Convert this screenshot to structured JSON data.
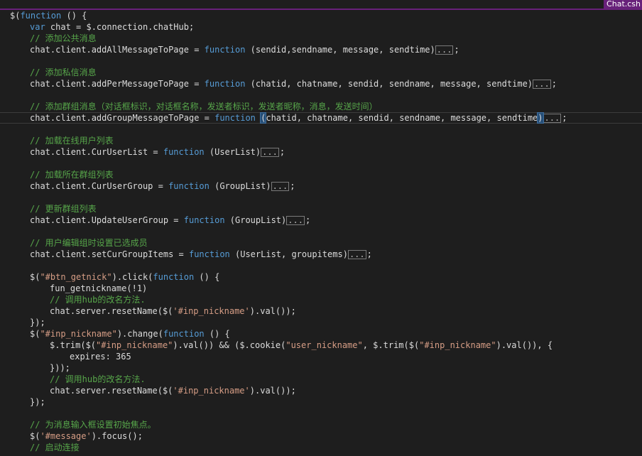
{
  "window": {
    "tab_label": "Chat.csh"
  },
  "code_lines": [
    {
      "indent": 0,
      "tokens": [
        {
          "t": "pl",
          "v": "$("
        },
        {
          "t": "kw",
          "v": "function"
        },
        {
          "t": "pl",
          "v": " () {"
        }
      ]
    },
    {
      "indent": 1,
      "tokens": [
        {
          "t": "kw",
          "v": "var"
        },
        {
          "t": "pl",
          "v": " chat = $.connection.chatHub;"
        }
      ]
    },
    {
      "indent": 1,
      "tokens": [
        {
          "t": "cmt",
          "v": "// 添加公共消息"
        }
      ]
    },
    {
      "indent": 1,
      "tokens": [
        {
          "t": "pl",
          "v": "chat.client.addAllMessageToPage = "
        },
        {
          "t": "kw",
          "v": "function"
        },
        {
          "t": "pl",
          "v": " (sendid,sendname, message, sendtime)"
        },
        {
          "t": "fold",
          "v": "..."
        },
        {
          "t": "pl",
          "v": ";"
        }
      ]
    },
    {
      "indent": 1,
      "tokens": []
    },
    {
      "indent": 1,
      "tokens": [
        {
          "t": "cmt",
          "v": "// 添加私信消息"
        }
      ]
    },
    {
      "indent": 1,
      "tokens": [
        {
          "t": "pl",
          "v": "chat.client.addPerMessageToPage = "
        },
        {
          "t": "kw",
          "v": "function"
        },
        {
          "t": "pl",
          "v": " (chatid, chatname, sendid, sendname, message, sendtime)"
        },
        {
          "t": "fold",
          "v": "..."
        },
        {
          "t": "pl",
          "v": ";"
        }
      ]
    },
    {
      "indent": 1,
      "tokens": []
    },
    {
      "indent": 1,
      "tokens": [
        {
          "t": "cmt",
          "v": "// 添加群组消息（对话框标识，对话框名称，发送者标识，发送者昵称，消息，发送时间）"
        }
      ]
    },
    {
      "indent": 1,
      "current": true,
      "tokens": [
        {
          "t": "pl",
          "v": "chat.client.addGroupMessageToPage = "
        },
        {
          "t": "kw",
          "v": "function"
        },
        {
          "t": "pl",
          "v": " "
        },
        {
          "t": "bm",
          "v": "("
        },
        {
          "t": "pl",
          "v": "chatid, chatname, sendid, sendname, message, sendtime"
        },
        {
          "t": "bm",
          "v": ")"
        },
        {
          "t": "fold",
          "v": "..."
        },
        {
          "t": "pl",
          "v": ";"
        }
      ]
    },
    {
      "indent": 1,
      "tokens": []
    },
    {
      "indent": 1,
      "tokens": [
        {
          "t": "cmt",
          "v": "// 加载在线用户列表"
        }
      ]
    },
    {
      "indent": 1,
      "tokens": [
        {
          "t": "pl",
          "v": "chat.client.CurUserList = "
        },
        {
          "t": "kw",
          "v": "function"
        },
        {
          "t": "pl",
          "v": " (UserList)"
        },
        {
          "t": "fold",
          "v": "..."
        },
        {
          "t": "pl",
          "v": ";"
        }
      ]
    },
    {
      "indent": 1,
      "tokens": []
    },
    {
      "indent": 1,
      "tokens": [
        {
          "t": "cmt",
          "v": "// 加载所在群组列表"
        }
      ]
    },
    {
      "indent": 1,
      "tokens": [
        {
          "t": "pl",
          "v": "chat.client.CurUserGroup = "
        },
        {
          "t": "kw",
          "v": "function"
        },
        {
          "t": "pl",
          "v": " (GroupList)"
        },
        {
          "t": "fold",
          "v": "..."
        },
        {
          "t": "pl",
          "v": ";"
        }
      ]
    },
    {
      "indent": 1,
      "tokens": []
    },
    {
      "indent": 1,
      "tokens": [
        {
          "t": "cmt",
          "v": "// 更新群组列表"
        }
      ]
    },
    {
      "indent": 1,
      "tokens": [
        {
          "t": "pl",
          "v": "chat.client.UpdateUserGroup = "
        },
        {
          "t": "kw",
          "v": "function"
        },
        {
          "t": "pl",
          "v": " (GroupList)"
        },
        {
          "t": "fold",
          "v": "..."
        },
        {
          "t": "pl",
          "v": ";"
        }
      ]
    },
    {
      "indent": 1,
      "tokens": []
    },
    {
      "indent": 1,
      "tokens": [
        {
          "t": "cmt",
          "v": "// 用户编辑组时设置已选成员"
        }
      ]
    },
    {
      "indent": 1,
      "tokens": [
        {
          "t": "pl",
          "v": "chat.client.setCurGroupItems = "
        },
        {
          "t": "kw",
          "v": "function"
        },
        {
          "t": "pl",
          "v": " (UserList, groupitems)"
        },
        {
          "t": "fold",
          "v": "..."
        },
        {
          "t": "pl",
          "v": ";"
        }
      ]
    },
    {
      "indent": 1,
      "tokens": []
    },
    {
      "indent": 1,
      "tokens": [
        {
          "t": "pl",
          "v": "$("
        },
        {
          "t": "str",
          "v": "\"#btn_getnick\""
        },
        {
          "t": "pl",
          "v": ").click("
        },
        {
          "t": "kw",
          "v": "function"
        },
        {
          "t": "pl",
          "v": " () {"
        }
      ]
    },
    {
      "indent": 2,
      "tokens": [
        {
          "t": "pl",
          "v": "fun_getnickname(!1)"
        }
      ]
    },
    {
      "indent": 2,
      "tokens": [
        {
          "t": "cmt",
          "v": "// 调用hub的改名方法."
        }
      ]
    },
    {
      "indent": 2,
      "tokens": [
        {
          "t": "pl",
          "v": "chat.server.resetName($("
        },
        {
          "t": "str",
          "v": "'#inp_nickname'"
        },
        {
          "t": "pl",
          "v": ").val());"
        }
      ]
    },
    {
      "indent": 1,
      "tokens": [
        {
          "t": "pl",
          "v": "});"
        }
      ]
    },
    {
      "indent": 1,
      "tokens": [
        {
          "t": "pl",
          "v": "$("
        },
        {
          "t": "str",
          "v": "\"#inp_nickname\""
        },
        {
          "t": "pl",
          "v": ").change("
        },
        {
          "t": "kw",
          "v": "function"
        },
        {
          "t": "pl",
          "v": " () {"
        }
      ]
    },
    {
      "indent": 2,
      "tokens": [
        {
          "t": "pl",
          "v": "$.trim($("
        },
        {
          "t": "str",
          "v": "\"#inp_nickname\""
        },
        {
          "t": "pl",
          "v": ").val()) && ($.cookie("
        },
        {
          "t": "str",
          "v": "\"user_nickname\""
        },
        {
          "t": "pl",
          "v": ", $.trim($("
        },
        {
          "t": "str",
          "v": "\"#inp_nickname\""
        },
        {
          "t": "pl",
          "v": ").val()), {"
        }
      ]
    },
    {
      "indent": 3,
      "tokens": [
        {
          "t": "pl",
          "v": "expires: 365"
        }
      ]
    },
    {
      "indent": 2,
      "tokens": [
        {
          "t": "pl",
          "v": "}));"
        }
      ]
    },
    {
      "indent": 2,
      "tokens": [
        {
          "t": "cmt",
          "v": "// 调用hub的改名方法."
        }
      ]
    },
    {
      "indent": 2,
      "tokens": [
        {
          "t": "pl",
          "v": "chat.server.resetName($("
        },
        {
          "t": "str",
          "v": "'#inp_nickname'"
        },
        {
          "t": "pl",
          "v": ").val());"
        }
      ]
    },
    {
      "indent": 1,
      "tokens": [
        {
          "t": "pl",
          "v": "});"
        }
      ]
    },
    {
      "indent": 1,
      "tokens": []
    },
    {
      "indent": 1,
      "tokens": [
        {
          "t": "cmt",
          "v": "// 为消息输入框设置初始焦点。"
        }
      ]
    },
    {
      "indent": 1,
      "tokens": [
        {
          "t": "pl",
          "v": "$("
        },
        {
          "t": "str",
          "v": "'#message'"
        },
        {
          "t": "pl",
          "v": ").focus();"
        }
      ]
    },
    {
      "indent": 1,
      "tokens": [
        {
          "t": "cmt",
          "v": "// 启动连接"
        }
      ]
    }
  ],
  "colors": {
    "background": "#1e1e1e",
    "keyword": "#569cd6",
    "string": "#d69d85",
    "comment": "#57a64a",
    "plain": "#dcdcdc",
    "active_tab": "#68217a"
  }
}
